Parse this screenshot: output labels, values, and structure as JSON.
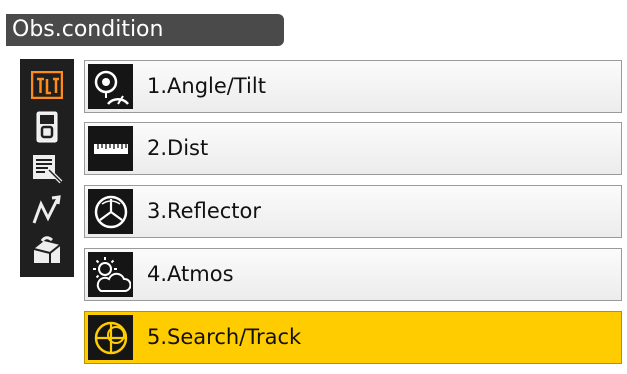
{
  "window": {
    "title": "Obs.condition"
  },
  "sidebar": {
    "icons": [
      {
        "name": "obs-condition-icon",
        "active": true
      },
      {
        "name": "instrument-icon",
        "active": false
      },
      {
        "name": "notes-icon",
        "active": false
      },
      {
        "name": "graph-icon",
        "active": false
      },
      {
        "name": "toolbox-icon",
        "active": false
      }
    ]
  },
  "menu": {
    "items": [
      {
        "label": "1.Angle/Tilt",
        "icon": "angle-tilt-icon",
        "selected": false
      },
      {
        "label": "2.Dist",
        "icon": "distance-ruler-icon",
        "selected": false
      },
      {
        "label": "3.Reflector",
        "icon": "reflector-icon",
        "selected": false
      },
      {
        "label": "4.Atmos",
        "icon": "atmos-weather-icon",
        "selected": false
      },
      {
        "label": "5.Search/Track",
        "icon": "search-track-icon",
        "selected": true
      }
    ]
  },
  "colors": {
    "title_bar": "#4a4a4a",
    "selected": "#ffcc00",
    "active_sidebar_icon": "#ff8c1a",
    "icon_background": "#151515"
  }
}
